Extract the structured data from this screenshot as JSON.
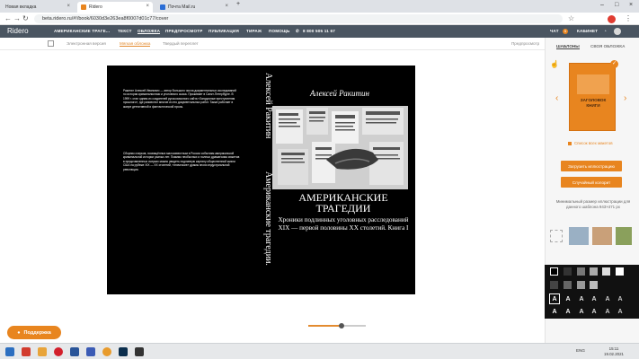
{
  "browser": {
    "tabs": [
      {
        "label": "Новая вкладка"
      },
      {
        "label": "Ridero"
      },
      {
        "label": "Почта Mail.ru"
      }
    ],
    "url": "beta.ridero.ru/#!/book/6030d3e263ea8f0007d01c77/cover"
  },
  "app": {
    "logo": "Ridero",
    "menu": [
      "АМЕРИКАНСКИЕ ТРАГЕ...",
      "ТЕКСТ",
      "ОБЛОЖКА",
      "ПРЕДПРОСМОТР",
      "ПУБЛИКАЦИЯ",
      "ТИРАЖ",
      "ПОМОЩЬ"
    ],
    "phone": "8 800 505 11 67",
    "chat": "ЧАТ",
    "cabinet": "КАБИНЕТ",
    "notif_count": "5"
  },
  "subtabs": [
    "Электронная версия",
    "Мягкая обложка",
    "Твердый переплет"
  ],
  "preview_link": "Предпросмотр",
  "book": {
    "back_paragraph_1": "Ракитин Алексей Иванович — автор большого числа документальных исследований по истории криминалистики и уголовного сыска. Проживает в Санкт-Петербурге. В 1999 г. стал одним из создателей русскоязычного сайта «Загадочные преступления прошлого», где разместил многие из его документальных работ. Также работает в жанре детективной и фантастической прозы.",
    "back_paragraph_2": "Сборник очерков, посвящённых малоизвестным в России событиям американской криминальной истории разных лет. Помимо необычных и полных драматизма сюжетов в представленных очерках можно увидеть подлинную картину общественной жизни США на рубеже XIX — XX столетий, «эпические» драмы эпохи индустриальной революции.",
    "spine_author": "Алексей Ракитин",
    "spine_title": "Американские трагедии.",
    "author": "Алексей Ракитин",
    "title_line1": "АМЕРИКАНСКИЕ",
    "title_line2": "ТРАГЕДИИ",
    "subtitle": "Хроники подлинных уголовных расследований XIX — первой половины XX столетий. Книга I"
  },
  "support_label": "Поддержка",
  "panel": {
    "tab_templates": "ШАБЛОНЫ",
    "tab_own": "СВОЯ ОБЛОЖКА",
    "thumb_text_1": "ЗАГОЛОВОК",
    "thumb_text_2": "КНИГИ",
    "all_templates": "Список всех макетов",
    "upload_illustration": "Загрузить иллюстрацию",
    "random_colors": "Случайный колорит",
    "min_size_note": "Минимальный размер иллюстрации для данного шаблона 943×471 px",
    "letter": "A"
  },
  "taskbar": {
    "lang": "ENG",
    "time": "15:11",
    "date": "19.02.2021"
  },
  "colors": {
    "accent": "#e8851f",
    "header": "#4a5561",
    "cover_bg": "#000000"
  }
}
